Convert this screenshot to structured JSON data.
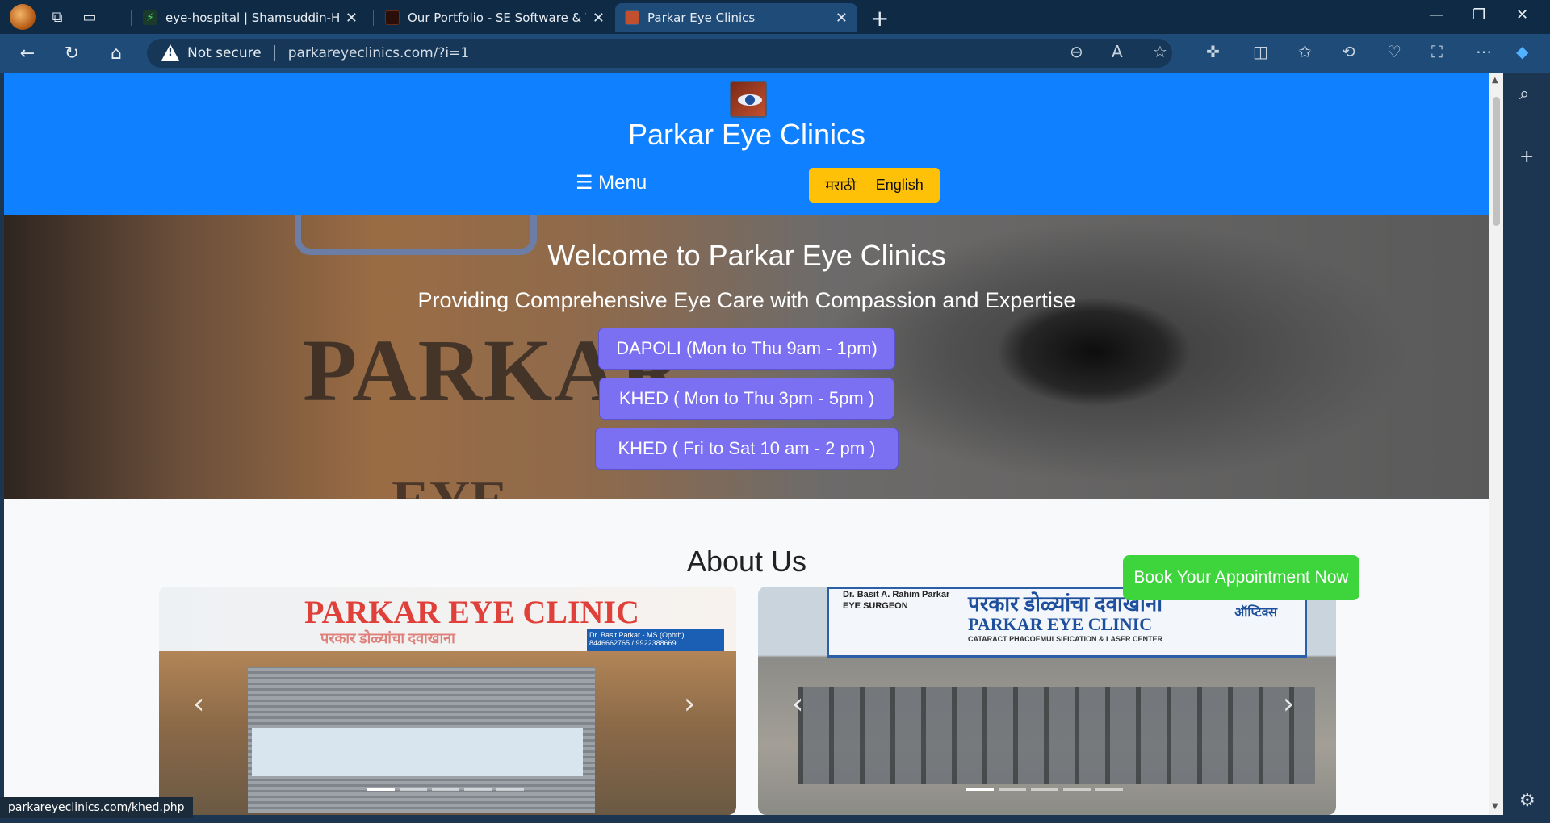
{
  "browser": {
    "tabs": [
      {
        "title": "eye-hospital | Shamsuddin-Hamd",
        "favicon_color": "#2a8c4a"
      },
      {
        "title": "Our Portfolio - SE Software & Wel",
        "favicon_color": "#5a1a10"
      },
      {
        "title": "Parkar Eye Clinics",
        "favicon_color": "#c24f2d"
      }
    ],
    "address": {
      "security": "Not secure",
      "url": "parkareyeclinics.com/?i=1"
    },
    "status_url": "parkareyeclinics.com/khed.php"
  },
  "site": {
    "title": "Parkar Eye Clinics",
    "menu_label": "☰ Menu",
    "lang_marathi": "मराठी",
    "lang_english": "English",
    "hero": {
      "heading": "Welcome to Parkar Eye Clinics",
      "subheading": "Providing Comprehensive Eye Care with Compassion and Expertise",
      "backdrop_word": "PARKAR",
      "backdrop_word2": "EYE",
      "hours": [
        "DAPOLI (Mon to Thu 9am - 1pm)",
        "KHED ( Mon to Thu 3pm - 5pm )",
        "KHED ( Fri to Sat 10 am - 2 pm )"
      ]
    },
    "about_heading": "About Us",
    "book_button": "Book Your Appointment Now",
    "carousel_left": {
      "sign_main": "PARKAR EYE CLINIC",
      "sign_sub": "परकार डोळ्यांचा दवाखाना",
      "doctor": "Dr. Basit Parkar - MS (Ophth)",
      "phone": "8446662765 / 9922388669"
    },
    "carousel_right": {
      "sign_top": "Dr. Basit A. Rahim Parkar",
      "sign_role": "EYE SURGEON",
      "sign_main": "परकार डोळ्यांचा दवाखाना",
      "sign_en": "PARKAR EYE CLINIC",
      "sign_sub": "CATARACT PHACOEMULSIFICATION & LASER CENTER",
      "optics": "ऑप्टिक्स"
    }
  }
}
